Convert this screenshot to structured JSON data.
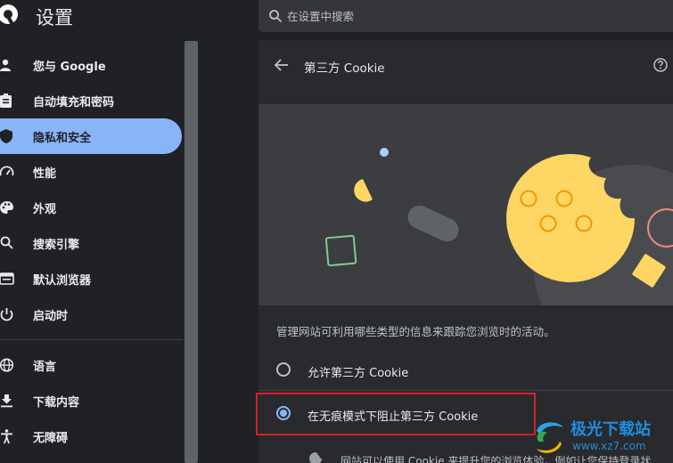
{
  "header": {
    "title": "设置",
    "search_placeholder": "在设置中搜索"
  },
  "sidebar": {
    "items": [
      {
        "label": "您与 Google",
        "icon": "person-icon"
      },
      {
        "label": "自动填充和密码",
        "icon": "clipboard-icon"
      },
      {
        "label": "隐私和安全",
        "icon": "shield-icon",
        "active": true
      },
      {
        "label": "性能",
        "icon": "speedometer-icon"
      },
      {
        "label": "外观",
        "icon": "palette-icon"
      },
      {
        "label": "搜索引擎",
        "icon": "search-icon"
      },
      {
        "label": "默认浏览器",
        "icon": "browser-icon"
      },
      {
        "label": "启动时",
        "icon": "power-icon"
      },
      {
        "label": "语言",
        "icon": "globe-icon"
      },
      {
        "label": "下载内容",
        "icon": "download-icon"
      },
      {
        "label": "无障碍",
        "icon": "accessibility-icon"
      }
    ]
  },
  "page": {
    "title": "第三方 Cookie",
    "description": "管理网站可利用哪些类型的信息来跟踪您浏览时的活动。",
    "options": [
      {
        "label": "允许第三方 Cookie",
        "selected": false
      },
      {
        "label": "在无痕模式下阻止第三方 Cookie",
        "selected": true
      }
    ],
    "partial_text": "网站可以使用 Cookie 来提升您的浏览体验，例如让您保持登录状"
  },
  "watermark": {
    "title": "极光下载站",
    "url": "www.xz7.com"
  },
  "colors": {
    "accent": "#8ab4f8",
    "background": "#202124",
    "card": "#292a2d",
    "highlight": "#d3202a",
    "cookie": "#fdd663"
  }
}
